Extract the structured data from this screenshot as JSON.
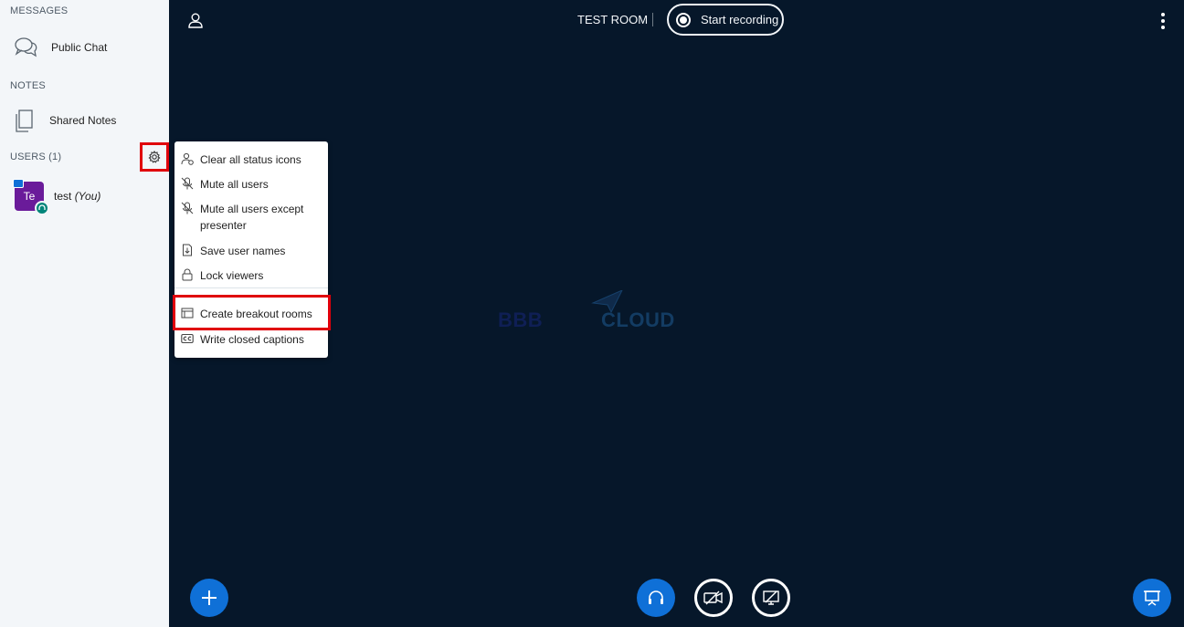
{
  "sidebar": {
    "messages_title": "MESSAGES",
    "public_chat_label": "Public Chat",
    "notes_title": "NOTES",
    "shared_notes_label": "Shared Notes",
    "users_title": "USERS (1)",
    "user": {
      "initials": "Te",
      "name": "test",
      "you_tag": "(You)"
    }
  },
  "topbar": {
    "room_title": "TEST ROOM",
    "record_label": "Start recording"
  },
  "watermark": {
    "part_a": "BBB",
    "part_b": "CLOUD"
  },
  "menu": {
    "items": [
      {
        "label": "Clear all status icons",
        "icon": "user-clear-icon"
      },
      {
        "label": "Mute all users",
        "icon": "mic-off-icon"
      },
      {
        "label": "Mute all users except presenter",
        "icon": "mic-off-icon"
      },
      {
        "label": "Save user names",
        "icon": "download-file-icon"
      },
      {
        "label": "Lock viewers",
        "icon": "lock-icon"
      },
      {
        "label": "Create breakout rooms",
        "icon": "breakout-room-icon"
      },
      {
        "label": "Write closed captions",
        "icon": "closed-caption-icon"
      }
    ]
  },
  "colors": {
    "background": "#06172a",
    "sidebar": "#f3f6f9",
    "accent": "#0f70d7",
    "highlight": "#e0000b",
    "avatar": "#6a1b9a"
  }
}
